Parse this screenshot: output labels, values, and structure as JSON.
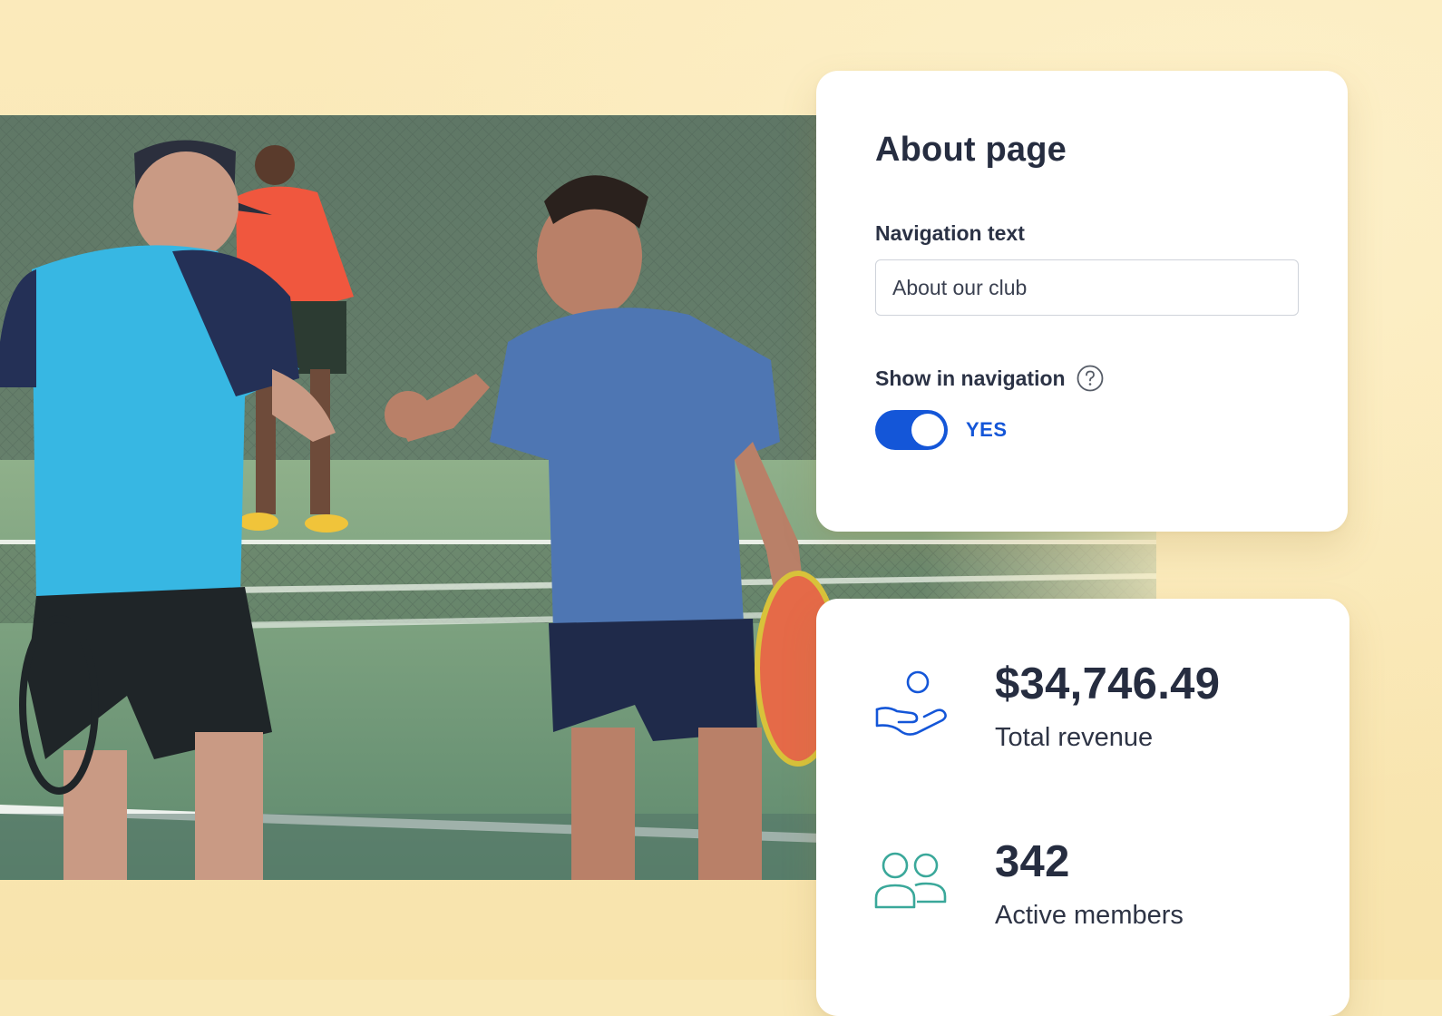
{
  "about_card": {
    "title": "About page",
    "navigation_text_label": "Navigation text",
    "navigation_text_value": "About our club",
    "show_in_navigation_label": "Show in navigation",
    "toggle_state_label": "YES"
  },
  "stats_card": {
    "revenue": {
      "value": "$34,746.49",
      "label": "Total revenue",
      "icon": "hand-coin-icon"
    },
    "members": {
      "value": "342",
      "label": "Active members",
      "icon": "members-icon"
    }
  },
  "colors": {
    "background": "#f9e8b6",
    "accent_blue": "#1456d8",
    "members_icon_teal": "#3aa89a",
    "heading_text": "#262d40"
  }
}
